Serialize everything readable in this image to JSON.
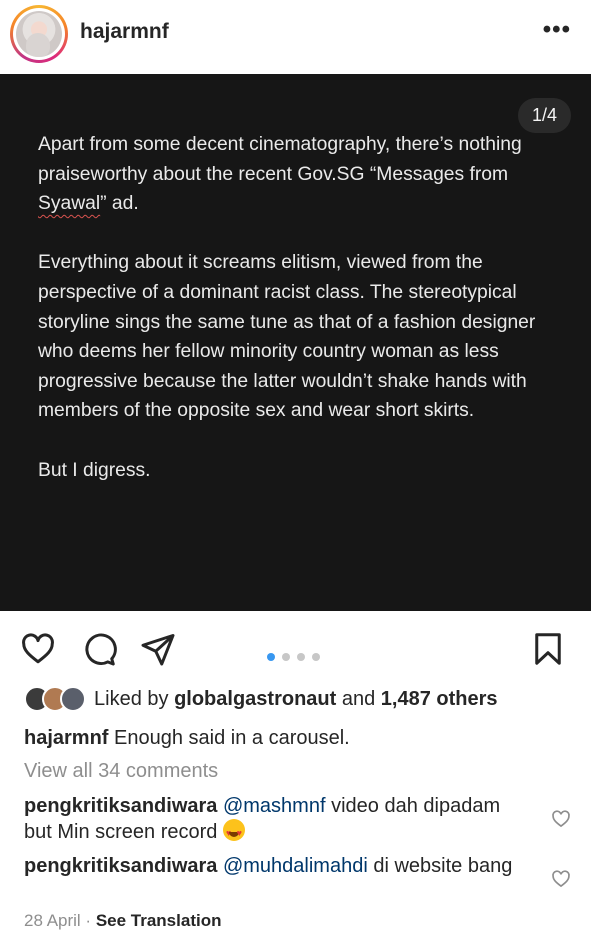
{
  "header": {
    "username": "hajarmnf",
    "more_icon": "more-horizontal-icon"
  },
  "post": {
    "counter": "1/4",
    "paragraphs": [
      {
        "before": "Apart from some decent cinematography, there’s nothing praiseworthy about the recent Gov.SG “Messages from ",
        "squiggle": "Syawal",
        "after": "” ad."
      },
      {
        "before": "Everything about it screams elitism, viewed from the perspective of a dominant racist class.  The stereotypical storyline sings the same tune as that of a fashion designer who deems her fellow minority country woman as less progressive because the latter wouldn’t shake hands with members of the opposite sex and wear short skirts.",
        "squiggle": "",
        "after": ""
      },
      {
        "before": "But I digress.",
        "squiggle": "",
        "after": ""
      }
    ]
  },
  "actions": {
    "icons": [
      "heart-icon",
      "comment-icon",
      "share-icon",
      "bookmark-icon"
    ],
    "carousel_count": 4,
    "carousel_active": 1
  },
  "likes": {
    "prefix": "Liked by ",
    "user": "globalgastronaut",
    "middle": " and ",
    "count": "1,487 others"
  },
  "caption": {
    "user": "hajarmnf",
    "text": " Enough said in a carousel."
  },
  "view_all": "View all 34 comments",
  "comments": [
    {
      "user": "pengkritiksandiwara",
      "mention": "@mashmnf",
      "text": " video dah dipadam but Min screen record "
    },
    {
      "user": "pengkritiksandiwara",
      "mention": "@muhdalimahdi",
      "text": " di website bang"
    }
  ],
  "footer": {
    "date": "28 April",
    "separator": " · ",
    "translate": "See Translation"
  },
  "colors": {
    "post_bg": "#161616",
    "mention": "#00376b",
    "carousel_active": "#3897f0"
  }
}
